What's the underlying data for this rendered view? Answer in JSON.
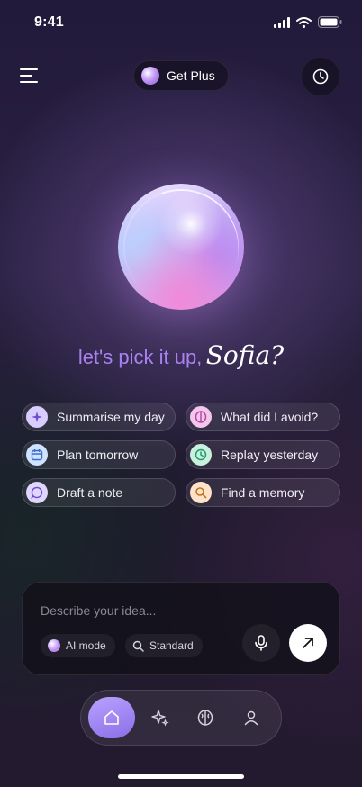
{
  "status_bar": {
    "time": "9:41"
  },
  "header": {
    "get_plus_label": "Get Plus"
  },
  "greeting": {
    "text": "let's pick it up,",
    "name": "Sofia?"
  },
  "suggestions": [
    {
      "label": "Summarise my day",
      "icon": "sparkle-icon",
      "color": "#d9ccff"
    },
    {
      "label": "What did I avoid?",
      "icon": "brain-icon",
      "color": "#f5c6ec"
    },
    {
      "label": "Plan tomorrow",
      "icon": "calendar-icon",
      "color": "#cfe2ff"
    },
    {
      "label": "Replay yesterday",
      "icon": "clock-icon",
      "color": "#c9f0df"
    },
    {
      "label": "Draft a note",
      "icon": "chat-bubble-icon",
      "color": "#e2d6ff"
    },
    {
      "label": "Find a memory",
      "icon": "search-icon",
      "color": "#ffe3c9"
    }
  ],
  "composer": {
    "placeholder": "Describe your idea...",
    "ai_mode_label": "AI mode",
    "standard_label": "Standard"
  },
  "nav": {
    "items": [
      "home-icon",
      "sparkle-icon",
      "brain-icon",
      "person-icon"
    ],
    "active": "home-icon"
  },
  "colors": {
    "accent": "#a982ef",
    "nav_active": "#8a6ee6"
  }
}
